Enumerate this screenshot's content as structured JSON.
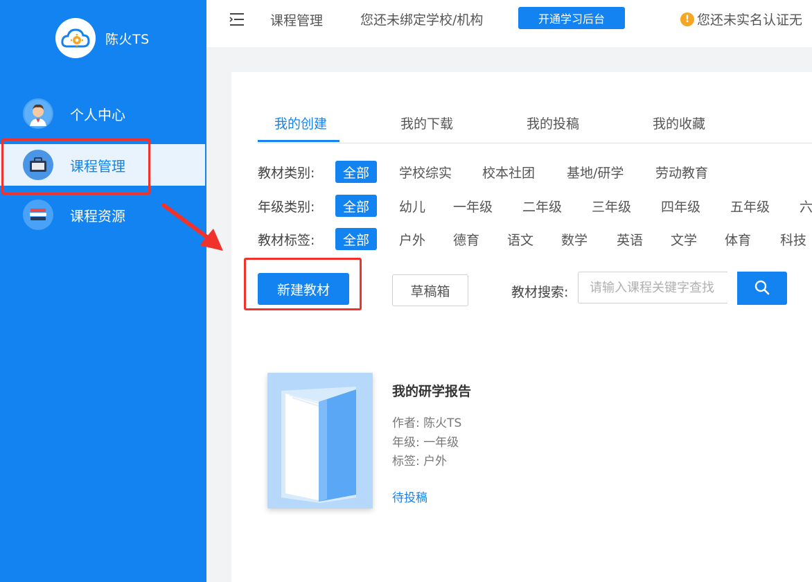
{
  "sidebar": {
    "brand_name": "陈火TS",
    "items": [
      {
        "label": "个人中心",
        "icon": "avatar-icon"
      },
      {
        "label": "课程管理",
        "icon": "briefcase-icon"
      },
      {
        "label": "课程资源",
        "icon": "books-icon"
      }
    ],
    "active_index": 1
  },
  "topbar": {
    "breadcrumb": "课程管理",
    "unbound_notice": "您还未绑定学校/机构",
    "open_backend_label": "开通学习后台",
    "warning_text": "您还未实名认证无"
  },
  "tabs": [
    {
      "label": "我的创建"
    },
    {
      "label": "我的下载"
    },
    {
      "label": "我的投稿"
    },
    {
      "label": "我的收藏"
    }
  ],
  "filters": {
    "material_type": {
      "label": "教材类别:",
      "options": [
        "全部",
        "学校综实",
        "校本社团",
        "基地/研学",
        "劳动教育"
      ]
    },
    "grade_type": {
      "label": "年级类别:",
      "options": [
        "全部",
        "幼儿",
        "一年级",
        "二年级",
        "三年级",
        "四年级",
        "五年级",
        "六"
      ]
    },
    "material_tag": {
      "label": "教材标签:",
      "options": [
        "全部",
        "户外",
        "德育",
        "语文",
        "数学",
        "英语",
        "文学",
        "体育",
        "科技"
      ]
    }
  },
  "actions": {
    "new_material_label": "新建教材",
    "drafts_label": "草稿箱",
    "search_label": "教材搜索:",
    "search_placeholder": "请输入课程关键字查找",
    "search_value": ""
  },
  "book": {
    "title": "我的研学报告",
    "author": "作者: 陈火TS",
    "grade": "年级: 一年级",
    "tag": "标签: 户外",
    "status": "待投稿"
  },
  "colors": {
    "primary": "#1383f2",
    "sidebar_active_bg": "#e8f3fe",
    "annotation_red": "#f0322b",
    "warning": "#f5a623"
  }
}
